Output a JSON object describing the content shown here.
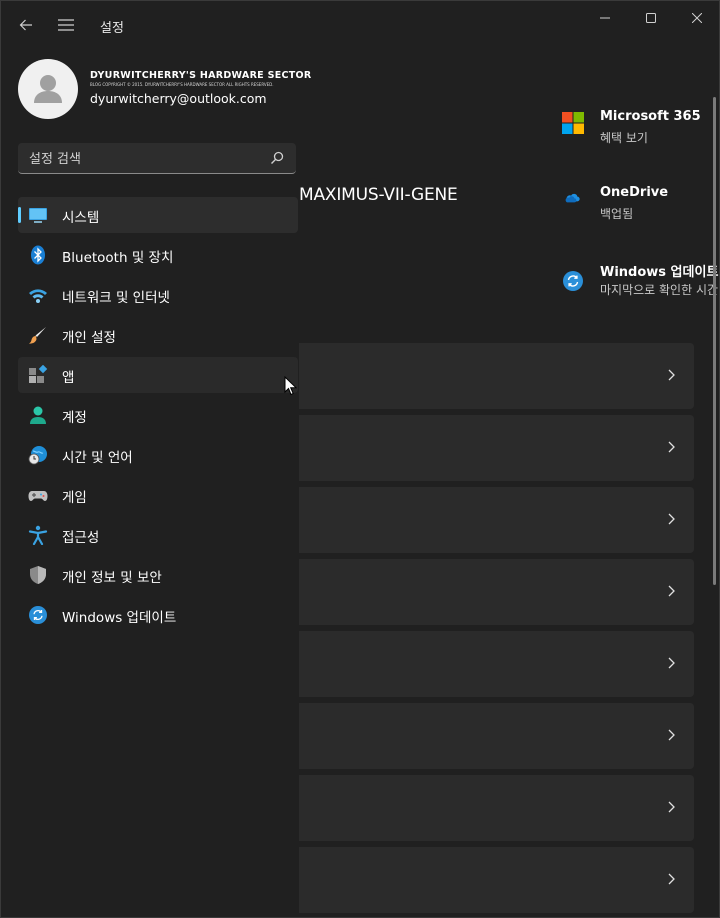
{
  "window": {
    "title": "설정"
  },
  "profile": {
    "brand": "DYURWITCHERRY'S HARDWARE SECTOR",
    "copyright": "BLOG COPYRIGHT © 2015. DYURWITCHERRY'S HARDWARE SECTOR ALL RIGHTS RESERVED.",
    "email": "dyurwitcherry@outlook.com"
  },
  "search": {
    "placeholder": "설정 검색"
  },
  "nav": {
    "items": [
      {
        "label": "시스템",
        "icon": "monitor-icon",
        "selected": true
      },
      {
        "label": "Bluetooth 및 장치",
        "icon": "bluetooth-icon"
      },
      {
        "label": "네트워크 및 인터넷",
        "icon": "wifi-icon"
      },
      {
        "label": "개인 설정",
        "icon": "brush-icon"
      },
      {
        "label": "앱",
        "icon": "apps-icon",
        "hover": true
      },
      {
        "label": "계정",
        "icon": "person-icon"
      },
      {
        "label": "시간 및 언어",
        "icon": "globe-clock-icon"
      },
      {
        "label": "게임",
        "icon": "gamepad-icon"
      },
      {
        "label": "접근성",
        "icon": "accessibility-icon"
      },
      {
        "label": "개인 정보 및 보안",
        "icon": "shield-icon"
      },
      {
        "label": "Windows 업데이트",
        "icon": "update-icon"
      }
    ]
  },
  "main": {
    "device_name": "MAXIMUS-VII-GENE",
    "quick_cards": [
      {
        "title": "Microsoft 365",
        "subtitle": "혜택 보기",
        "icon": "microsoft-logo-icon"
      },
      {
        "title": "OneDrive",
        "subtitle": "백업됨",
        "icon": "onedrive-cloud-icon"
      },
      {
        "title": "Windows 업데이트",
        "subtitle": "마지막으로 확인한 시간",
        "icon": "update-icon"
      }
    ]
  },
  "colors": {
    "background": "#202020",
    "card": "#2b2b2b",
    "accent": "#60cdff"
  }
}
